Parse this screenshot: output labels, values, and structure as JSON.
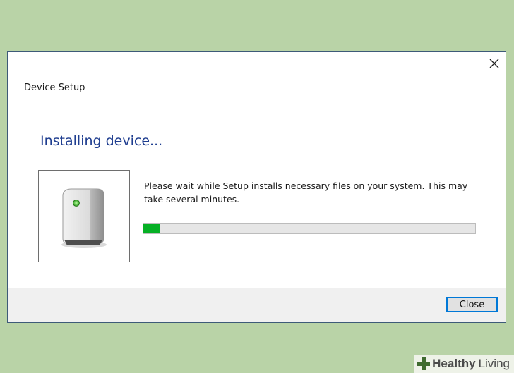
{
  "dialog": {
    "title": "Device Setup",
    "heading": "Installing device...",
    "message": "Please wait while Setup installs necessary files on your system. This may take several minutes.",
    "progress_percent": 5,
    "close_button_label": "Close"
  },
  "icons": {
    "close": "close-icon",
    "device": "external-drive-icon"
  },
  "watermark": {
    "word1": "Healthy",
    "word2": "Living"
  },
  "colors": {
    "background": "#b9d3a7",
    "heading": "#1e3d8f",
    "progress": "#06b025",
    "button_focus": "#0078d7"
  }
}
